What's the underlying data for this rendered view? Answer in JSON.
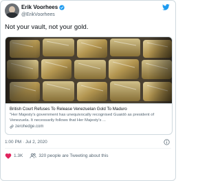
{
  "tweet": {
    "author_name": "Erik Voorhees",
    "author_handle": "@ErikVoorhees",
    "text": "Not your vault, not your gold.",
    "timestamp": "1:00 PM · Jul 2, 2020"
  },
  "card": {
    "title": "British Court Refuses To Release Venezuelan Gold To Maduro",
    "description": "\"Her Majesty's government has unequivocally recognised Guaidó as president of Venezuela. It necessarily follows that Her Majesty's ...",
    "domain": "zerohedge.com"
  },
  "actions": {
    "likes": "1.3K",
    "people_tweeting": "320 people are Tweeting about this"
  },
  "colors": {
    "accent": "#1d9bf0",
    "like": "#e0245e",
    "text": "#0f1419",
    "muted": "#536471",
    "border": "#cfd9de"
  },
  "icons": [
    "avatar",
    "verified-badge-icon",
    "twitter-bird-icon",
    "link-icon",
    "info-icon",
    "heart-icon",
    "people-icon"
  ]
}
